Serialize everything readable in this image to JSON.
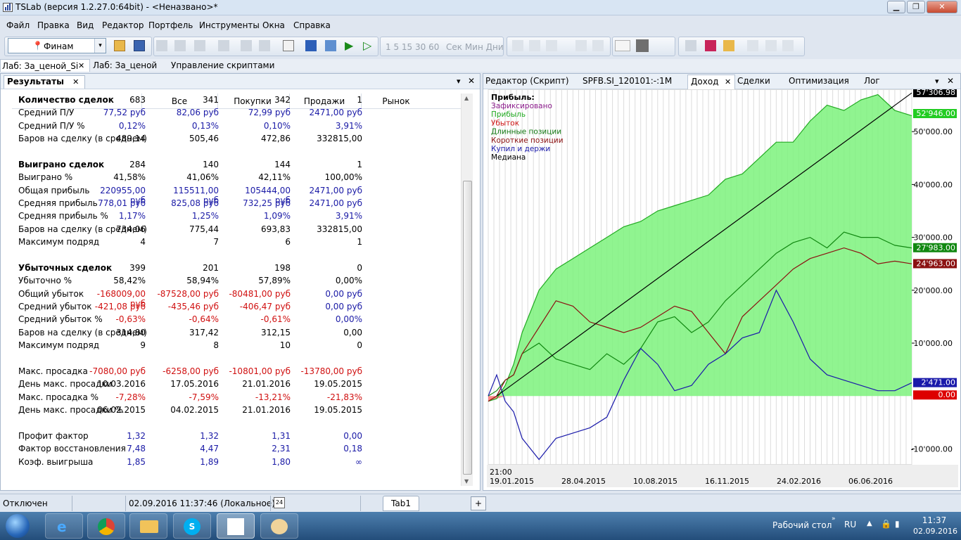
{
  "window": {
    "title": "TSLab (версия 1.2.27.0:64bit) - <Неназвано>*",
    "minimize": "▁",
    "restore": "❐",
    "close": "✕"
  },
  "menu": [
    "Файл",
    "Правка",
    "Вид",
    "Редактор",
    "Портфель",
    "Инструменты",
    "Окна",
    "Справка"
  ],
  "toolbar": {
    "provider": "Финам",
    "nums": "1  5  15  30  60",
    "periods": "Сек  Мин  Дни",
    "combo_arrow": "▾"
  },
  "doc_tabs": [
    {
      "label": "Лаб: За_ценой_Si",
      "close": "✕"
    },
    {
      "label": "Лаб: За_ценой"
    },
    {
      "label": "Управление скриптами"
    }
  ],
  "results": {
    "tab": "Результаты",
    "close": "✕",
    "menu_arrow": "▾",
    "pane_close": "✕",
    "columns": [
      "Все",
      "Покупки",
      "Продажи",
      "Рынок"
    ],
    "rows": [
      {
        "label": "Количество сделок",
        "bold": true,
        "values": [
          "683",
          "341",
          "342",
          "1"
        ],
        "color": "black"
      },
      {
        "label": "Средний П/У",
        "values": [
          "77,52 руб",
          "82,06 руб",
          "72,99 руб",
          "2471,00 руб"
        ],
        "color": "blue"
      },
      {
        "label": "Средний П/У %",
        "values": [
          "0,12%",
          "0,13%",
          "0,10%",
          "3,91%"
        ],
        "color": "blue"
      },
      {
        "label": "Баров на сделку (в среднем)",
        "values": [
          "489,14",
          "505,46",
          "472,86",
          "332815,00"
        ],
        "color": "black"
      },
      {
        "label": "Выиграно сделок",
        "bold": true,
        "values": [
          "284",
          "140",
          "144",
          "1"
        ],
        "color": "black"
      },
      {
        "label": "Выиграно %",
        "values": [
          "41,58%",
          "41,06%",
          "42,11%",
          "100,00%"
        ],
        "color": "black"
      },
      {
        "label": "Общая прибыль",
        "values": [
          "220955,00 руб",
          "115511,00 руб",
          "105444,00 руб",
          "2471,00 руб"
        ],
        "color": "blue"
      },
      {
        "label": "Средняя прибыль",
        "values": [
          "778,01 руб",
          "825,08 руб",
          "732,25 руб",
          "2471,00 руб"
        ],
        "color": "blue"
      },
      {
        "label": "Средняя прибыль %",
        "values": [
          "1,17%",
          "1,25%",
          "1,09%",
          "3,91%"
        ],
        "color": "blue"
      },
      {
        "label": "Баров на сделку (в среднем)",
        "values": [
          "734,06",
          "775,44",
          "693,83",
          "332815,00"
        ],
        "color": "black"
      },
      {
        "label": "Максимум подряд",
        "values": [
          "4",
          "7",
          "6",
          "1"
        ],
        "color": "black"
      },
      {
        "label": "Убыточных сделок",
        "bold": true,
        "values": [
          "399",
          "201",
          "198",
          "0"
        ],
        "color": "black"
      },
      {
        "label": "Убыточно %",
        "values": [
          "58,42%",
          "58,94%",
          "57,89%",
          "0,00%"
        ],
        "color": "black"
      },
      {
        "label": "Общий убыток",
        "values": [
          "-168009,00 руб",
          "-87528,00 руб",
          "-80481,00 руб",
          "0,00 руб"
        ],
        "color": "red",
        "last_blue": true
      },
      {
        "label": "Средний убыток",
        "values": [
          "-421,08 руб",
          "-435,46 руб",
          "-406,47 руб",
          "0,00 руб"
        ],
        "color": "red",
        "last_blue": true
      },
      {
        "label": "Средний убыток %",
        "values": [
          "-0,63%",
          "-0,64%",
          "-0,61%",
          "0,00%"
        ],
        "color": "red",
        "last_blue": true
      },
      {
        "label": "Баров на сделку (в среднем)",
        "values": [
          "314,80",
          "317,42",
          "312,15",
          "0,00"
        ],
        "color": "black"
      },
      {
        "label": "Максимум подряд",
        "values": [
          "9",
          "8",
          "10",
          "0"
        ],
        "color": "black"
      },
      {
        "label": "Макс. просадка",
        "values": [
          "-7080,00 руб",
          "-6258,00 руб",
          "-10801,00 руб",
          "-13780,00 руб"
        ],
        "color": "red"
      },
      {
        "label": "День макс. просадки",
        "values": [
          "10.03.2016",
          "17.05.2016",
          "21.01.2016",
          "19.05.2015"
        ],
        "color": "black"
      },
      {
        "label": "Макс. просадка %",
        "values": [
          "-7,28%",
          "-7,59%",
          "-13,21%",
          "-21,83%"
        ],
        "color": "red"
      },
      {
        "label": "День макс. просадки %",
        "values": [
          "06.02.2015",
          "04.02.2015",
          "21.01.2016",
          "19.05.2015"
        ],
        "color": "black"
      },
      {
        "label": "Профит фактор",
        "values": [
          "1,32",
          "1,32",
          "1,31",
          "0,00"
        ],
        "color": "blue"
      },
      {
        "label": "Фактор восстановления",
        "values": [
          "7,48",
          "4,47",
          "2,31",
          "0,18"
        ],
        "color": "blue"
      },
      {
        "label": "Коэф. выигрыша",
        "values": [
          "1,85",
          "1,89",
          "1,80",
          "∞"
        ],
        "color": "blue"
      }
    ]
  },
  "right_tabs": [
    "Редактор (Скрипт)",
    "SPFB.SI_120101:-:1M",
    "Доход",
    "Сделки",
    "Оптимизация",
    "Лог"
  ],
  "right_tab_close": "✕",
  "chart_data": {
    "type": "line",
    "legend_title": "Прибыль:",
    "legend": [
      {
        "name": "Зафиксировано",
        "color": "#8b1a8b"
      },
      {
        "name": "Прибыль",
        "color": "#22aa22"
      },
      {
        "name": "Убыток",
        "color": "#cc1111"
      },
      {
        "name": "Длинные позиции",
        "color": "#117711"
      },
      {
        "name": "Короткие позиции",
        "color": "#8b1111"
      },
      {
        "name": "Купил и держи",
        "color": "#1a1aaa"
      },
      {
        "name": "Медиана",
        "color": "#000000"
      }
    ],
    "ylim": [
      -13000,
      58000
    ],
    "y_ticks": [
      "-10'000.00",
      "10'000.00",
      "20'000.00",
      "30'000.00",
      "40'000.00",
      "50'000.00"
    ],
    "y_tick_values": [
      -10000,
      10000,
      20000,
      30000,
      40000,
      50000
    ],
    "x_first_label": "21:00",
    "x_labels": [
      "19.01.2015",
      "28.04.2015",
      "10.08.2015",
      "16.11.2015",
      "24.02.2016",
      "06.06.2016"
    ],
    "value_badges": [
      {
        "text": "57'306.98",
        "value": 57306.98,
        "bg": "#000000",
        "fg": "#ffffff"
      },
      {
        "text": "52'946.00",
        "value": 52946,
        "bg": "#22cc22",
        "fg": "#ffffff"
      },
      {
        "text": "27'983.00",
        "value": 27983,
        "bg": "#118811",
        "fg": "#ffffff"
      },
      {
        "text": "24'963.00",
        "value": 24963,
        "bg": "#8b1111",
        "fg": "#ffffff"
      },
      {
        "text": "2'471.00",
        "value": 2471,
        "bg": "#1a1aaa",
        "fg": "#ffffff"
      },
      {
        "text": "0.00",
        "value": 0,
        "bg": "#dd0000",
        "fg": "#ffffff"
      }
    ],
    "series": [
      {
        "name": "Прибыль",
        "color": "#22aa22",
        "x": [
          0,
          2,
          4,
          6,
          8,
          12,
          16,
          20,
          24,
          28,
          32,
          36,
          40,
          44,
          48,
          52,
          56,
          60,
          64,
          68,
          72,
          76,
          80,
          84,
          88,
          92,
          96,
          100
        ],
        "y": [
          -1000,
          -500,
          2000,
          6000,
          12000,
          20000,
          24000,
          26000,
          28000,
          30000,
          32000,
          33000,
          35000,
          36000,
          37000,
          38000,
          41000,
          42000,
          45000,
          48000,
          48000,
          52000,
          55000,
          54000,
          56000,
          57000,
          54000,
          53000
        ]
      },
      {
        "name": "Длинные позиции",
        "color": "#118811",
        "x": [
          0,
          2,
          4,
          6,
          8,
          12,
          16,
          20,
          24,
          28,
          32,
          36,
          40,
          44,
          48,
          52,
          56,
          60,
          64,
          68,
          72,
          76,
          80,
          84,
          88,
          92,
          96,
          100
        ],
        "y": [
          0,
          1000,
          3000,
          4000,
          8000,
          10000,
          7000,
          6000,
          5000,
          8000,
          6000,
          9000,
          14000,
          15000,
          12000,
          14000,
          18000,
          21000,
          24000,
          27000,
          29000,
          30000,
          28000,
          31000,
          30000,
          30000,
          28500,
          28000
        ]
      },
      {
        "name": "Короткие позиции",
        "color": "#8b1111",
        "x": [
          0,
          2,
          4,
          6,
          8,
          12,
          16,
          20,
          24,
          28,
          32,
          36,
          40,
          44,
          48,
          52,
          56,
          60,
          64,
          68,
          72,
          76,
          80,
          84,
          88,
          92,
          96,
          100
        ],
        "y": [
          -1000,
          0,
          3000,
          4000,
          8000,
          13000,
          18000,
          17000,
          14000,
          13000,
          12000,
          13000,
          15000,
          17000,
          16000,
          12000,
          8000,
          15000,
          18000,
          21000,
          24000,
          26000,
          27000,
          28000,
          27000,
          25000,
          25500,
          25000
        ]
      },
      {
        "name": "Купил и держи",
        "color": "#1a1aaa",
        "x": [
          0,
          2,
          4,
          6,
          8,
          12,
          16,
          20,
          24,
          28,
          32,
          36,
          40,
          44,
          48,
          52,
          56,
          60,
          64,
          68,
          72,
          76,
          80,
          84,
          88,
          92,
          96,
          100
        ],
        "y": [
          0,
          4000,
          -1000,
          -3000,
          -8000,
          -12000,
          -8000,
          -7000,
          -6000,
          -4000,
          3000,
          9000,
          6000,
          1000,
          2000,
          6000,
          8000,
          11000,
          12000,
          20000,
          14000,
          7000,
          4000,
          3000,
          2000,
          1000,
          1000,
          2500
        ]
      },
      {
        "name": "Медиана",
        "color": "#000000",
        "x": [
          2,
          100
        ],
        "y": [
          0,
          57306.98
        ]
      }
    ]
  },
  "status": {
    "state": "Отключен",
    "datetime": "02.09.2016 11:37:46 (Локальное)",
    "calendar_day": "24",
    "tab": "Tab1",
    "add": "+"
  },
  "taskbar": {
    "desktop": "Рабочий стол",
    "lang": "RU",
    "time": "11:37",
    "date": "02.09.2016"
  }
}
